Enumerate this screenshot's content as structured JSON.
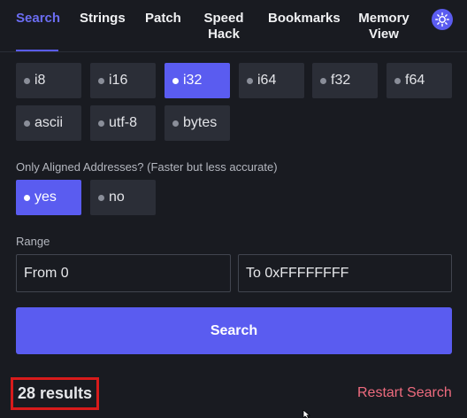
{
  "nav": {
    "tabs": [
      {
        "label": "Search",
        "active": true
      },
      {
        "label": "Strings"
      },
      {
        "label": "Patch"
      },
      {
        "label": "Speed Hack"
      },
      {
        "label": "Bookmarks"
      },
      {
        "label": "Memory View"
      }
    ],
    "theme_icon": "sun-icon"
  },
  "types": {
    "options": [
      "i8",
      "i16",
      "i32",
      "i64",
      "f32",
      "f64",
      "ascii",
      "utf-8",
      "bytes"
    ],
    "selected": "i32"
  },
  "aligned": {
    "label": "Only Aligned Addresses? (Faster but less accurate)",
    "options": [
      "yes",
      "no"
    ],
    "selected": "yes"
  },
  "range": {
    "label": "Range",
    "from_value": "From 0",
    "to_value": "To 0xFFFFFFFF"
  },
  "search_button": "Search",
  "results_text": "28 results",
  "restart_link": "Restart Search",
  "colors": {
    "accent": "#5a5cf0",
    "background": "#191b21",
    "option_bg": "#2b2e37",
    "restart": "#ee6b7e",
    "highlight_box": "#d81b1b"
  }
}
